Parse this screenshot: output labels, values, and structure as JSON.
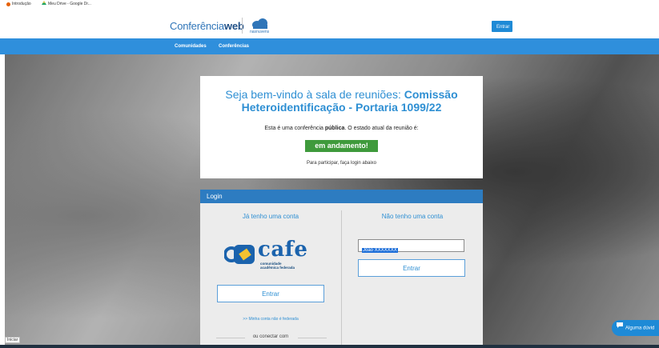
{
  "bookmarks": [
    {
      "label": "Introdução",
      "icon": "firefox-icon",
      "color": "#e66000"
    },
    {
      "label": "Meu Drive - Google Dr...",
      "icon": "google-drive-icon",
      "color": "#1fa463"
    }
  ],
  "header": {
    "logo_light": "Conferência",
    "logo_bold": "web",
    "partner_label": "nasnuvens",
    "login_button": "Entrar"
  },
  "nav": {
    "items": [
      "Comunidades",
      "Conferências"
    ]
  },
  "welcome": {
    "title_prefix": "Seja bem-vindo à sala de reuniões:",
    "title_room": "Comissão Heteroidentificação - Portaria 1099/22",
    "info_prefix": "Esta é uma conferência",
    "info_type": "pública",
    "info_suffix": ". O estado atual da reunião é:",
    "status": "em andamento!",
    "hint": "Para participar, faça login abaixo"
  },
  "login": {
    "title": "Login",
    "left_title": "Já tenho uma conta",
    "cafe_word": "cafe",
    "cafe_sub1": "comunidade",
    "cafe_sub2": "acadêmica federada",
    "left_button": "Entrar",
    "not_federated_link": ">> Minha conta não é federada",
    "connect_with": "ou conectar com",
    "right_title": "Não tenho uma conta",
    "name_value": "João XXXXXXX",
    "right_button": "Entrar"
  },
  "chat": {
    "label": "Alguma dúvid"
  },
  "taskbar": {
    "start_label": "Iniciar"
  },
  "colors": {
    "brand": "#2f8fdc",
    "status_green": "#3f9a3c",
    "title_blue": "#2e8fd3"
  }
}
